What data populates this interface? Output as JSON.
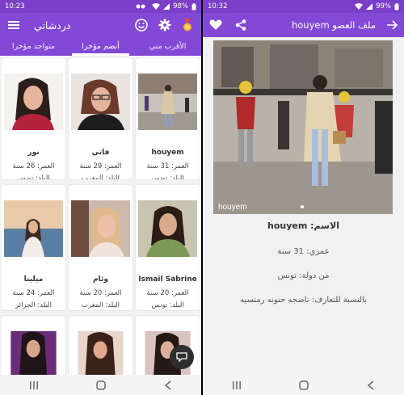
{
  "left": {
    "status": {
      "time": "10:23",
      "battery": "98%"
    },
    "appbar": {
      "title": "دردشاتي"
    },
    "tabs": [
      {
        "label": "الأقرب مني",
        "active": false
      },
      {
        "label": "أنضم مؤخرا",
        "active": true
      },
      {
        "label": "متواجد مؤخرا",
        "active": false
      }
    ],
    "profiles": [
      {
        "name": "houyem",
        "age": "العمر: 31 سنة",
        "country": "البلد: تونس"
      },
      {
        "name": "فاتي",
        "age": "العمر: 29 سنة",
        "country": "البلد: المغرب"
      },
      {
        "name": "نور",
        "age": "العمر: 26 سنة",
        "country": "البلد: تونس"
      },
      {
        "name": "Ismail Sabrine",
        "age": "العمر: 20 سنة",
        "country": "البلد: تونس"
      },
      {
        "name": "وئام",
        "age": "العمر: 20 سنة",
        "country": "البلد: المغرب"
      },
      {
        "name": "ميلينا",
        "age": "العمر: 24 سنة",
        "country": "البلد: الجزائر"
      }
    ],
    "colors": {
      "primary": "#8348d6",
      "status": "#7a3ec9"
    }
  },
  "right": {
    "status": {
      "time": "10:32",
      "battery": "99%"
    },
    "appbar": {
      "title": "ملف العضو houyem"
    },
    "photo_caption": "houyem",
    "details": {
      "name_line": "الاسم: houyem",
      "age_line": "عمري: 31 سنة",
      "country_line": "من دولة: تونس",
      "relation_line": "بالنسبة للتعارف: ناضجه حنونه رمنسيه"
    }
  }
}
